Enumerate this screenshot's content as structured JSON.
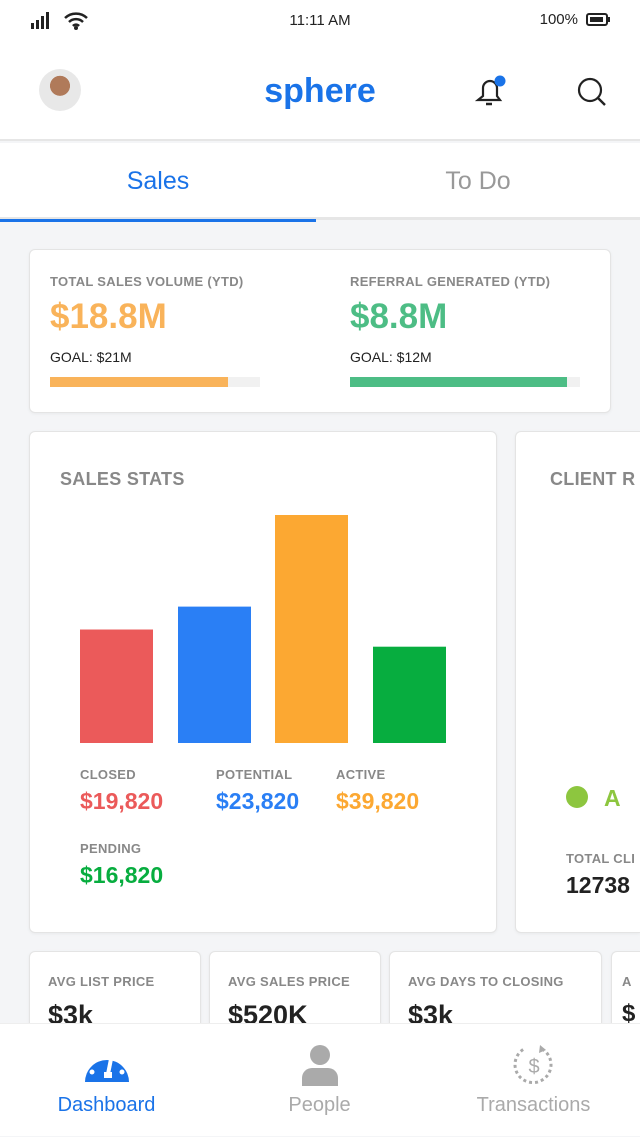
{
  "status": {
    "time": "11:11 AM",
    "battery": "100%"
  },
  "header": {
    "title": "sphere",
    "notification_dot_color": "#1a73e8"
  },
  "tabs": [
    {
      "label": "Sales",
      "active": true
    },
    {
      "label": "To Do",
      "active": false
    }
  ],
  "summary": [
    {
      "label": "TOTAL SALES VOLUME (YTD)",
      "value": "$18.8M",
      "goal": "GOAL: $21M",
      "progress": 0.848,
      "color": "#f9b35a"
    },
    {
      "label": "REFERRAL GENERATED (YTD)",
      "value": "$8.8M",
      "goal": "GOAL: $12M",
      "progress": 0.943,
      "color": "#4dbd85"
    }
  ],
  "sales_stats": {
    "title": "SALES STATS"
  },
  "chart_data": {
    "type": "bar",
    "categories": [
      "CLOSED",
      "POTENTIAL",
      "ACTIVE",
      "PENDING"
    ],
    "values": [
      19820,
      23820,
      39820,
      16820
    ],
    "labels": [
      "$19,820",
      "$23,820",
      "$39,820",
      "$16,820"
    ],
    "colors": [
      "#eb5a5a",
      "#2a7ff5",
      "#fca832",
      "#07ad3f"
    ],
    "title": "SALES STATS",
    "ylim": [
      0,
      39820
    ]
  },
  "client_card": {
    "title": "CLIENT R",
    "legend_label": "A",
    "legend_color": "#8dc63f",
    "total_label": "TOTAL CLI",
    "total_value": "12738"
  },
  "metrics": [
    {
      "label": "AVG LIST PRICE",
      "value": "$3k"
    },
    {
      "label": "AVG SALES PRICE",
      "value": "$520K"
    },
    {
      "label": "AVG DAYS TO CLOSING",
      "value": "$3k"
    },
    {
      "label": "A",
      "value": "$"
    }
  ],
  "nav": [
    {
      "label": "Dashboard",
      "icon": "dashboard-gauge-icon",
      "active": true
    },
    {
      "label": "People",
      "icon": "person-icon"
    },
    {
      "label": "Transactions",
      "icon": "dollar-cycle-icon"
    }
  ]
}
